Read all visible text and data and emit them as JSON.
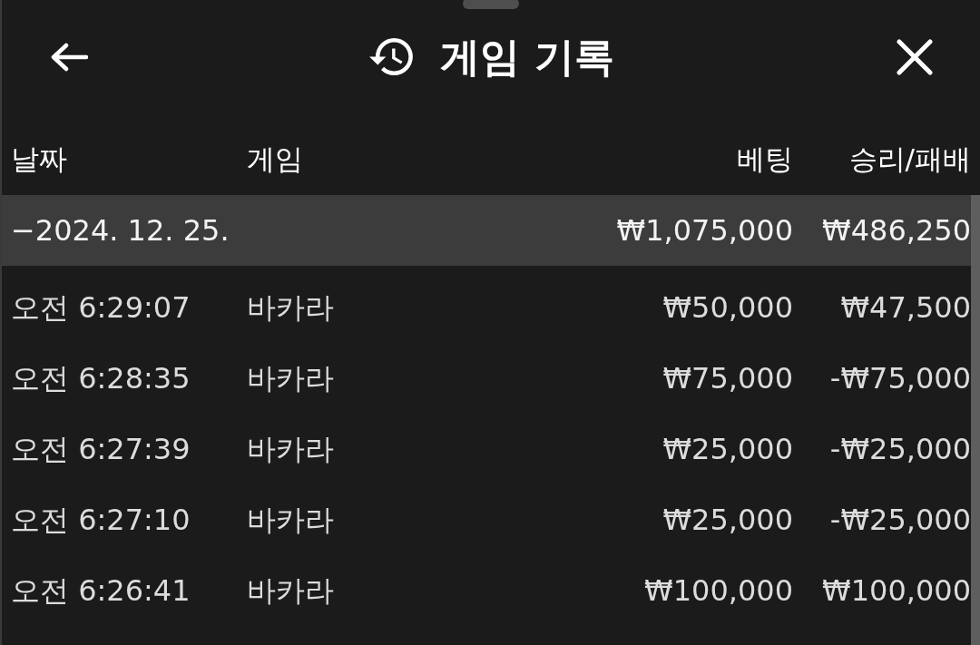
{
  "header": {
    "title": "게임 기록"
  },
  "table": {
    "columns": [
      "날짜",
      "게임",
      "베팅",
      "승리/패배"
    ],
    "groups": [
      {
        "toggle": "−",
        "date": "2024. 12. 25.",
        "expanded": true,
        "bet": "₩1,075,000",
        "result": "₩486,250",
        "rows": [
          {
            "time": "오전 6:29:07",
            "game": "바카라",
            "bet": "₩50,000",
            "result": "₩47,500"
          },
          {
            "time": "오전 6:28:35",
            "game": "바카라",
            "bet": "₩75,000",
            "result": "-₩75,000"
          },
          {
            "time": "오전 6:27:39",
            "game": "바카라",
            "bet": "₩25,000",
            "result": "-₩25,000"
          },
          {
            "time": "오전 6:27:10",
            "game": "바카라",
            "bet": "₩25,000",
            "result": "-₩25,000"
          },
          {
            "time": "오전 6:26:41",
            "game": "바카라",
            "bet": "₩100,000",
            "result": "₩100,000"
          }
        ]
      }
    ]
  }
}
